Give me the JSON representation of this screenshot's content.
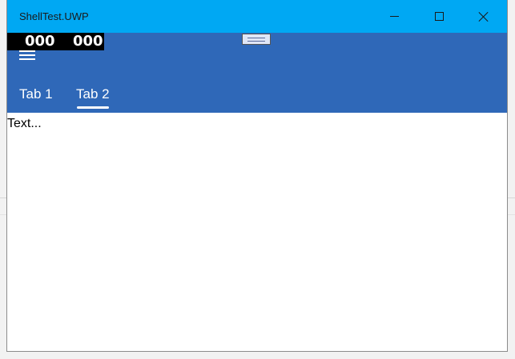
{
  "window": {
    "title": "ShellTest.UWP"
  },
  "counter": {
    "value_left": "000",
    "value_right": "000"
  },
  "tabs": [
    {
      "label": "Tab 1",
      "selected": false
    },
    {
      "label": "Tab 2",
      "selected": true
    }
  ],
  "content": {
    "text": "Text..."
  },
  "colors": {
    "titlebar": "#00a8f3",
    "appbar": "#2f68b8",
    "background": "#ffffff"
  },
  "icons": {
    "minimize": "minimize-icon",
    "maximize": "maximize-icon",
    "close": "close-icon",
    "menu": "hamburger-menu-icon",
    "drag": "drag-handle-icon"
  }
}
